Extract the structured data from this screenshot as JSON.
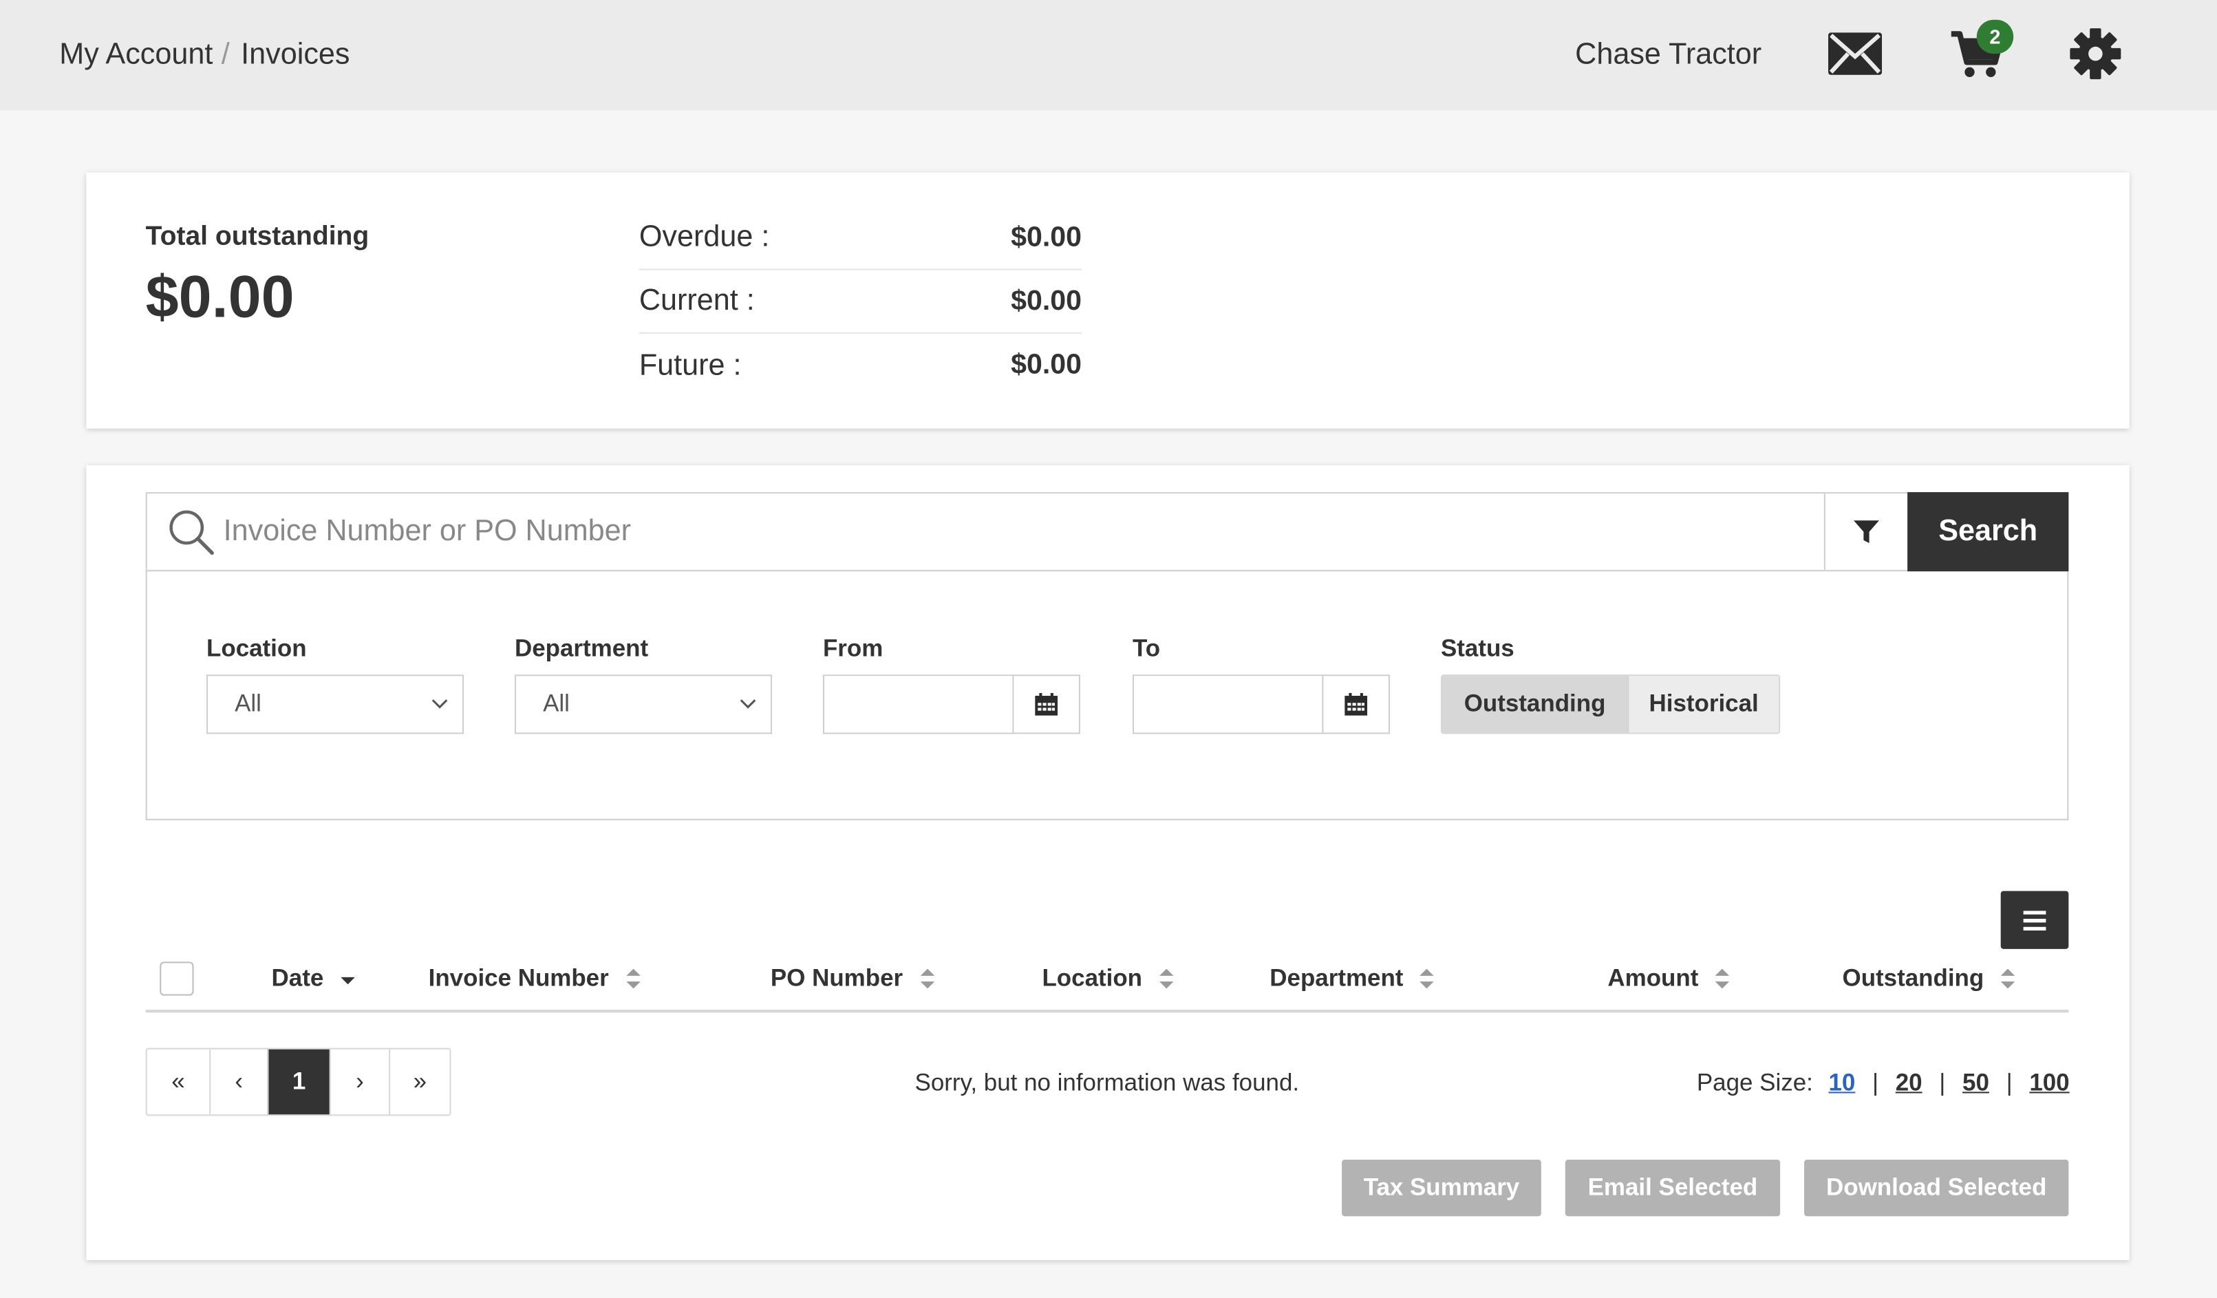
{
  "breadcrumb": {
    "account": "My Account",
    "separator": "/",
    "current": "Invoices"
  },
  "header": {
    "user_name": "Chase Tractor",
    "cart_count": "2"
  },
  "summary": {
    "total_label": "Total outstanding",
    "total_value": "$0.00",
    "rows": [
      {
        "label": "Overdue :",
        "value": "$0.00"
      },
      {
        "label": "Current :",
        "value": "$0.00"
      },
      {
        "label": "Future :",
        "value": "$0.00"
      }
    ]
  },
  "search": {
    "placeholder": "Invoice Number or PO Number",
    "button": "Search"
  },
  "filters": {
    "location_label": "Location",
    "location_value": "All",
    "department_label": "Department",
    "department_value": "All",
    "from_label": "From",
    "to_label": "To",
    "status_label": "Status",
    "status_outstanding": "Outstanding",
    "status_historical": "Historical"
  },
  "table": {
    "columns": [
      "Date",
      "Invoice Number",
      "PO Number",
      "Location",
      "Department",
      "Amount",
      "Outstanding"
    ],
    "empty_message": "Sorry, but no information was found."
  },
  "pagination": {
    "first": "«",
    "prev": "‹",
    "current": "1",
    "next": "›",
    "last": "»"
  },
  "page_size": {
    "label": "Page Size:",
    "options": [
      "10",
      "20",
      "50",
      "100"
    ],
    "separator": "|"
  },
  "actions": {
    "tax_summary": "Tax Summary",
    "email_selected": "Email Selected",
    "download_selected": "Download Selected"
  },
  "colors": {
    "dark": "#333333",
    "badge": "#2e7d32",
    "link_active": "#2b64b8",
    "disabled_button": "#b3b3b3"
  }
}
